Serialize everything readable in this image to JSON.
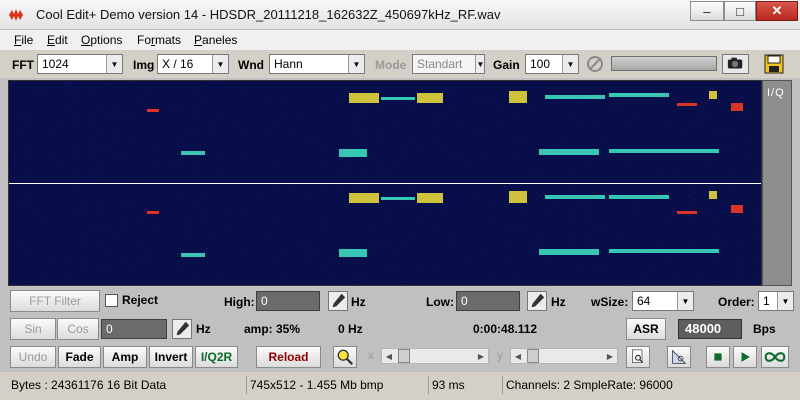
{
  "window": {
    "title": "Cool Edit+  Demo version 14 - HDSDR_20111218_162632Z_450697kHz_RF.wav",
    "minimize": "–",
    "maximize": "□",
    "close": "✕"
  },
  "menu": [
    {
      "label": "File",
      "u": "F",
      "rest": "ile"
    },
    {
      "label": "Edit",
      "u": "E",
      "rest": "dit"
    },
    {
      "label": "Options",
      "u": "O",
      "rest": "ptions"
    },
    {
      "label": "Formats",
      "pre": "Fo",
      "u": "r",
      "rest": "mats"
    },
    {
      "label": "Paneles",
      "u": "P",
      "rest": "aneles"
    }
  ],
  "toolbar": {
    "fft_label": "FFT",
    "fft_value": "1024",
    "img_label": "Img",
    "img_value": "X / 16",
    "wnd_label": "Wnd",
    "wnd_value": "Hann",
    "mode_label": "Mode",
    "mode_value": "Standart",
    "gain_label": "Gain",
    "gain_value": "100",
    "progress": 0
  },
  "spectrum": {
    "channel_label": "I/Q"
  },
  "filter_row": {
    "fft_filter": "FFT Filter",
    "reject": "Reject",
    "high_label": "High:",
    "high_value": "0",
    "high_unit": "Hz",
    "low_label": "Low:",
    "low_value": "0",
    "low_unit": "Hz",
    "wsize_label": "wSize:",
    "wsize_value": "64",
    "order_label": "Order:",
    "order_value": "1"
  },
  "signal_row": {
    "sin": "Sin",
    "cos": "Cos",
    "value": "0",
    "unit": "Hz",
    "amp": "amp: 35%",
    "freq": "0 Hz",
    "time": "0:00:48.112",
    "asr": "ASR",
    "rate": "48000",
    "rate_unit": "Bps"
  },
  "action_row": {
    "undo": "Undo",
    "fade": "Fade",
    "amp": "Amp",
    "invert": "Invert",
    "iq2r": "I/Q2R",
    "reload": "Reload",
    "x_symbol": "x",
    "y_symbol": "y"
  },
  "status": {
    "bytes": "Bytes : 24361176 16 Bit Data",
    "bmp": "745x512 - 1.455 Mb bmp",
    "ms": "93 ms",
    "channels": "Channels: 2  SmpleRate: 96000"
  },
  "colors": {
    "spectrum_bg": "#070e4a",
    "signal_hot": "#ff3b1f",
    "signal_warm": "#f2e23a",
    "signal_cool": "#3ee6c6"
  }
}
